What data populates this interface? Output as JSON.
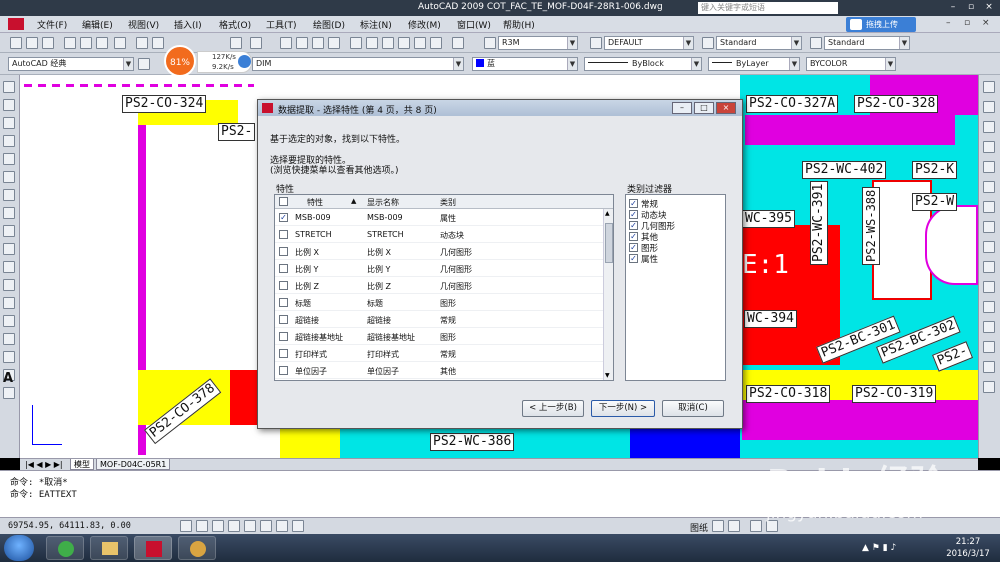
{
  "titlebar": {
    "title": "AutoCAD 2009 COT_FAC_TE_MOF-D04F-28R1-006.dwg",
    "search_placeholder": "键入关键字或短语"
  },
  "menubar": {
    "items": [
      "文件(F)",
      "编辑(E)",
      "视图(V)",
      "插入(I)",
      "格式(O)",
      "工具(T)",
      "绘图(D)",
      "标注(N)",
      "修改(M)",
      "窗口(W)",
      "帮助(H)"
    ],
    "upload_label": "拖拽上传"
  },
  "toolbar2": {
    "layer": "R3M",
    "dimstyle": "DEFAULT",
    "textstyle": "Standard",
    "tablestyle": "Standard"
  },
  "toolbar3": {
    "workspace": "AutoCAD 经典",
    "layer_dim": "DIM",
    "color": "蓝",
    "linetype": "ByBlock",
    "lineweight": "ByLayer",
    "plotstyle": "BYCOLOR",
    "color_hex": "#0000ff"
  },
  "speed": {
    "percent": "81%",
    "up": "127K/s",
    "down": "9.2K/s"
  },
  "canvas": {
    "labels": [
      "PS2-CO-324",
      "PS2-",
      "PS2-CO-327A",
      "PS2-CO-328",
      "PS2-WC-402",
      "PS2-K",
      "PS2-W",
      "WC-395",
      "E:1",
      "PS2-WC-391",
      "PS2-WS-388",
      "WC-394",
      "PS2-BC-301",
      "PS2-BC-302",
      "PS2-CO-378",
      "PS2-CO-318",
      "PS2-CO-319",
      "PS2-WC-386",
      "PS2-"
    ]
  },
  "dialog": {
    "title": "数据提取 - 选择特性 (第 4 页，共 8 页)",
    "line1": "基于选定的对象，找到以下特性。",
    "line2": "选择要提取的特性。",
    "line3": "(浏览快捷菜单以查看其他选项。)",
    "props_group": "特性",
    "filter_group": "类别过滤器",
    "col_prop": "特性",
    "col_display": "显示名称",
    "col_category": "类别",
    "rows": [
      {
        "checked": true,
        "prop": "MSB-009",
        "display": "MSB-009",
        "category": "属性"
      },
      {
        "checked": false,
        "prop": "STRETCH",
        "display": "STRETCH",
        "category": "动态块"
      },
      {
        "checked": false,
        "prop": "比例 X",
        "display": "比例 X",
        "category": "几何图形"
      },
      {
        "checked": false,
        "prop": "比例 Y",
        "display": "比例 Y",
        "category": "几何图形"
      },
      {
        "checked": false,
        "prop": "比例 Z",
        "display": "比例 Z",
        "category": "几何图形"
      },
      {
        "checked": false,
        "prop": "标题",
        "display": "标题",
        "category": "图形"
      },
      {
        "checked": false,
        "prop": "超链接",
        "display": "超链接",
        "category": "常规"
      },
      {
        "checked": false,
        "prop": "超链接基地址",
        "display": "超链接基地址",
        "category": "图形"
      },
      {
        "checked": false,
        "prop": "打印样式",
        "display": "打印样式",
        "category": "常规"
      },
      {
        "checked": false,
        "prop": "单位因子",
        "display": "单位因子",
        "category": "其他"
      }
    ],
    "filters": [
      {
        "checked": true,
        "label": "常规"
      },
      {
        "checked": true,
        "label": "动态块"
      },
      {
        "checked": true,
        "label": "几何图形"
      },
      {
        "checked": true,
        "label": "其他"
      },
      {
        "checked": true,
        "label": "图形"
      },
      {
        "checked": true,
        "label": "属性"
      }
    ],
    "back_label": "< 上一步(B)",
    "next_label": "下一步(N) >",
    "cancel_label": "取消(C)"
  },
  "tabs": {
    "model": "模型",
    "layout": "MOF-D04C-05R1"
  },
  "command": {
    "line1": "命令: *取消*",
    "line2": "命令: EATTEXT"
  },
  "status": {
    "coords": "69754.95, 64111.83, 0.00",
    "paper_label": "图纸"
  },
  "taskbar": {
    "time": "21:27",
    "date": "2016/3/17"
  },
  "watermark": {
    "main": "Baidu经验",
    "sub": "jingyan.baidu.com"
  }
}
